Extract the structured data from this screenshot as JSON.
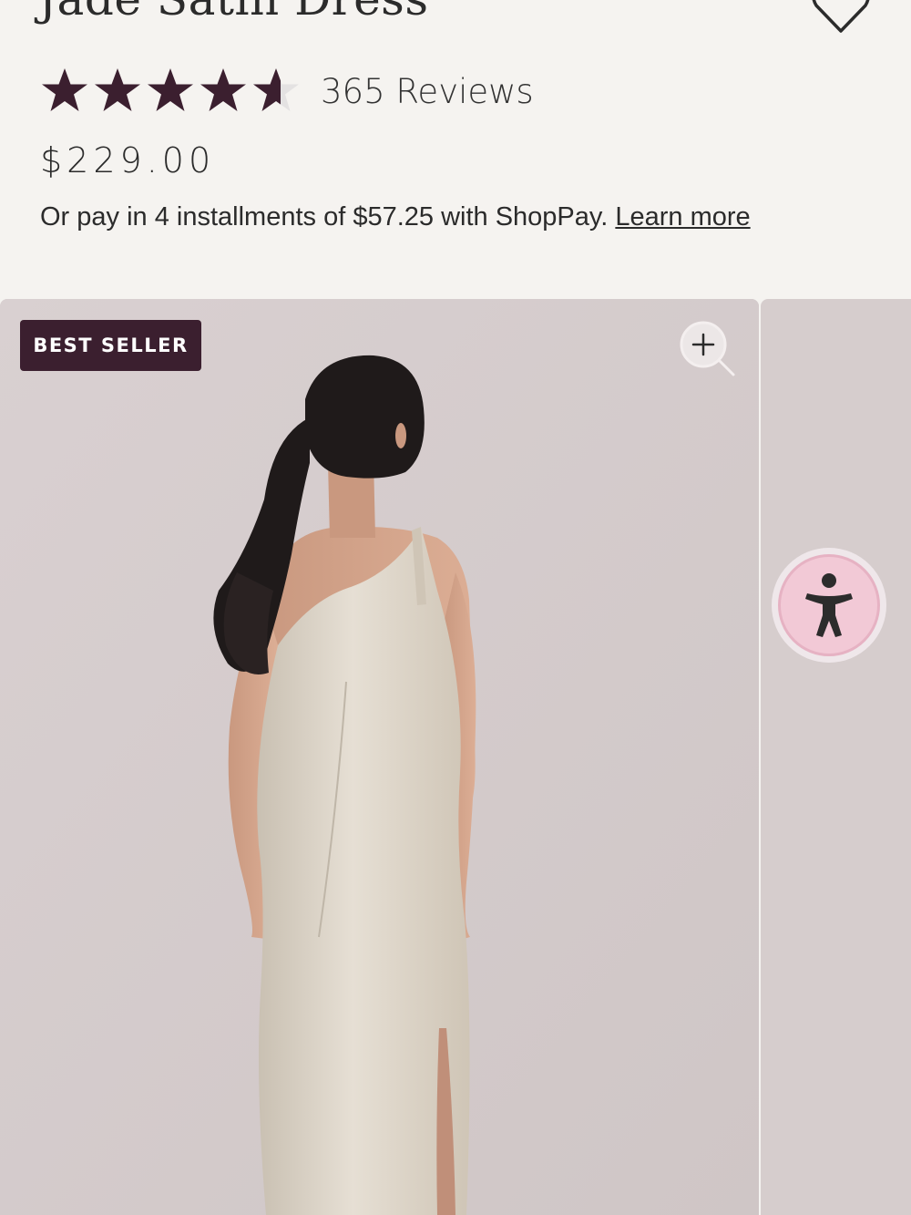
{
  "product": {
    "title": "Jade Satin Dress",
    "rating": 4.6,
    "rating_max": 5,
    "reviews_label": "365 Reviews",
    "price": "$229.00",
    "installments_text": "Or pay in 4 installments of $57.25 with ShopPay. ",
    "learn_more_label": "Learn more"
  },
  "gallery": {
    "badge_label": "BEST SELLER",
    "zoom_icon": "zoom-in-icon",
    "accessibility_icon": "accessibility-icon"
  },
  "colors": {
    "star": "#3b1f2f",
    "star_empty": "#e4e2e2",
    "badge_bg": "#3b1f2f",
    "photo_bg": "#d8cfcf",
    "accessibility_bg": "#f2c9d6"
  }
}
